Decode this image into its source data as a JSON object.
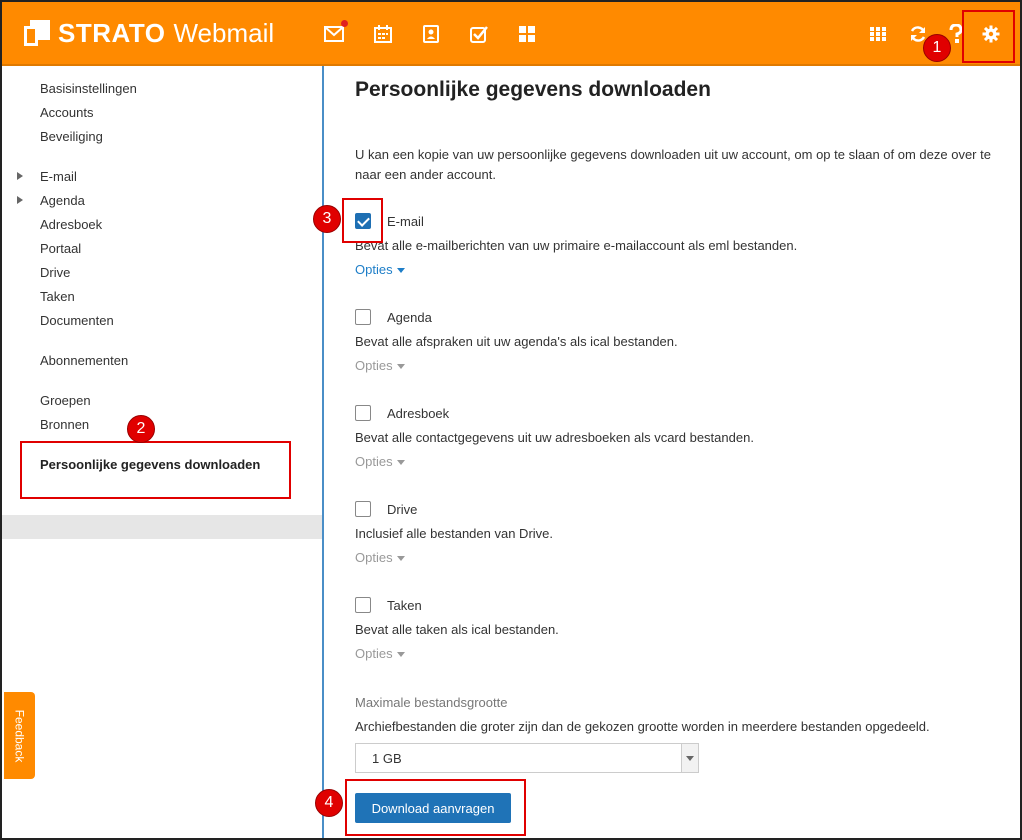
{
  "app": {
    "brand_bold": "STRATO",
    "brand_light": "Webmail"
  },
  "topbar": {
    "icons": [
      "mail-icon",
      "calendar-icon",
      "contacts-icon",
      "tasks-icon",
      "dashboard-icon",
      "apps-grid-icon",
      "refresh-icon",
      "help-icon",
      "settings-icon"
    ],
    "accent": "#ff8a00"
  },
  "sidebar": {
    "items": [
      {
        "label": "Basisinstellingen"
      },
      {
        "label": "Accounts"
      },
      {
        "label": "Beveiliging"
      },
      {
        "label": "E-mail"
      },
      {
        "label": "Agenda"
      },
      {
        "label": "Adresboek"
      },
      {
        "label": "Portaal"
      },
      {
        "label": "Drive"
      },
      {
        "label": "Taken"
      },
      {
        "label": "Documenten"
      },
      {
        "label": "Abonnementen"
      },
      {
        "label": "Groepen"
      },
      {
        "label": "Bronnen"
      },
      {
        "label": "Persoonlijke gegevens downloaden"
      }
    ],
    "feedback": "Feedback"
  },
  "main": {
    "title": "Persoonlijke gegevens downloaden",
    "intro_line1": "U kan een kopie van uw persoonlijke gegevens downloaden uit uw account, om op te slaan of om deze over te",
    "intro_line2": "naar een ander account.",
    "options": [
      {
        "label": "E-mail",
        "desc": "Bevat alle e-mailberichten van uw primaire e-mailaccount als eml bestanden.",
        "link": "Opties",
        "checked": true
      },
      {
        "label": "Agenda",
        "desc": "Bevat alle afspraken uit uw agenda's als ical bestanden.",
        "link": "Opties",
        "checked": false
      },
      {
        "label": "Adresboek",
        "desc": "Bevat alle contactgegevens uit uw adresboeken als vcard bestanden.",
        "link": "Opties",
        "checked": false
      },
      {
        "label": "Drive",
        "desc": "Inclusief alle bestanden van Drive.",
        "link": "Opties",
        "checked": false
      },
      {
        "label": "Taken",
        "desc": "Bevat alle taken als ical bestanden.",
        "link": "Opties",
        "checked": false
      }
    ],
    "size_label": "Maximale bestandsgrootte",
    "size_desc": "Archiefbestanden die groter zijn dan de gekozen grootte worden in meerdere bestanden opgedeeld.",
    "size_value": "1 GB",
    "download_button": "Download aanvragen"
  },
  "annotations": [
    "1",
    "2",
    "3",
    "4"
  ]
}
